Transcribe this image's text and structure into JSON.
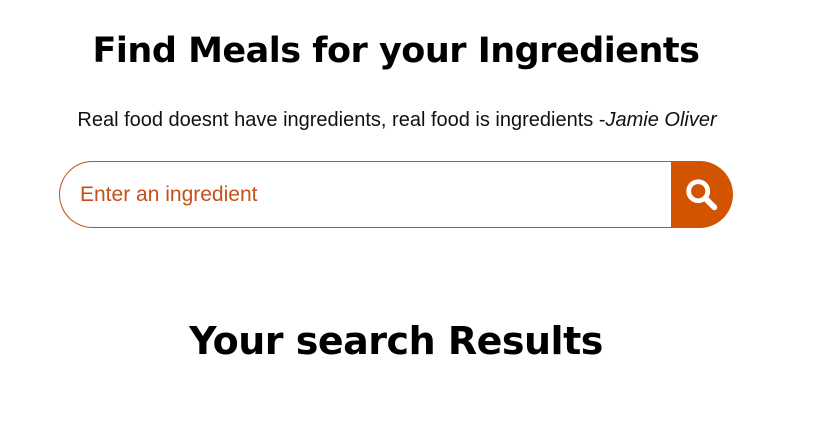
{
  "header": {
    "title": "Find Meals for your Ingredients",
    "quote_text": "Real food doesnt have ingredients, real food is ingredients -",
    "quote_author": "Jamie Oliver"
  },
  "search": {
    "placeholder": "Enter an ingredient",
    "value": "",
    "button_icon": "search-icon"
  },
  "results": {
    "title": "Your search Results"
  },
  "colors": {
    "accent": "#d35400",
    "input_border": "#c4501a",
    "text": "#000000",
    "background": "#ffffff"
  }
}
